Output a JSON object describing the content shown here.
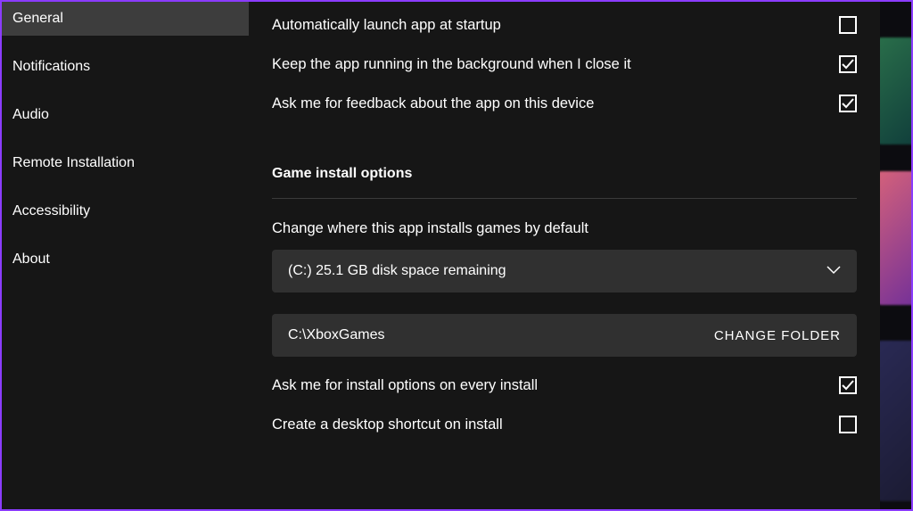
{
  "sidebar": {
    "items": [
      {
        "label": "General",
        "active": true
      },
      {
        "label": "Notifications",
        "active": false
      },
      {
        "label": "Audio",
        "active": false
      },
      {
        "label": "Remote Installation",
        "active": false
      },
      {
        "label": "Accessibility",
        "active": false
      },
      {
        "label": "About",
        "active": false
      }
    ]
  },
  "settings": {
    "auto_launch": {
      "label": "Automatically launch app at startup",
      "checked": false
    },
    "keep_running": {
      "label": "Keep the app running in the background when I close it",
      "checked": true
    },
    "feedback": {
      "label": "Ask me for feedback about the app on this device",
      "checked": true
    }
  },
  "install_options": {
    "header": "Game install options",
    "change_where_label": "Change where this app installs games by default",
    "drive_selected": "(C:) 25.1 GB disk space remaining",
    "folder_path": "C:\\XboxGames",
    "change_folder_btn": "CHANGE FOLDER",
    "ask_install": {
      "label": "Ask me for install options on every install",
      "checked": true
    },
    "desktop_shortcut": {
      "label": "Create a desktop shortcut on install",
      "checked": false
    }
  }
}
